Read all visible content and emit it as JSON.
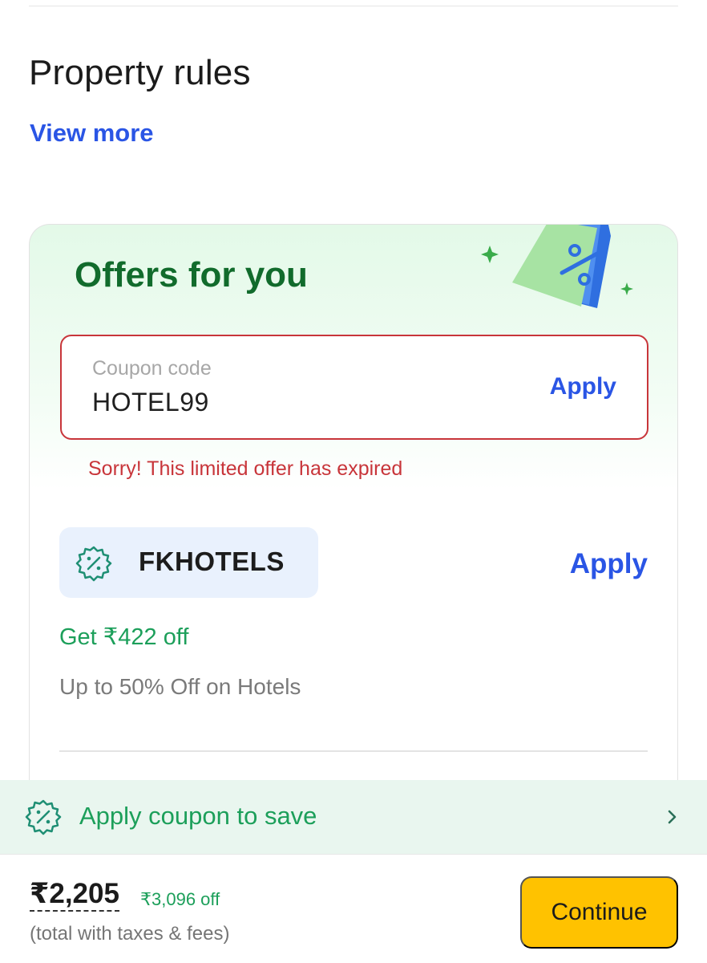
{
  "property_rules": {
    "title": "Property rules",
    "view_more": "View more"
  },
  "offers": {
    "title": "Offers for you",
    "coupon_input": {
      "label": "Coupon code",
      "value": "HOTEL99",
      "apply_label": "Apply",
      "error": "Sorry! This limited offer has expired"
    },
    "items": [
      {
        "code": "FKHOTELS",
        "apply_label": "Apply",
        "savings": "Get ₹422 off",
        "description": "Up to 50% Off on Hotels"
      }
    ]
  },
  "apply_strip": {
    "label": "Apply coupon to save"
  },
  "footer": {
    "price": "₹2,205",
    "discount": "₹3,096 off",
    "tax_note": "(total with taxes & fees)",
    "continue_label": "Continue"
  },
  "icons": {
    "coupon": "discount-badge-icon",
    "chevron": "chevron-right-icon",
    "tag": "percent-tag-illustration",
    "sparkle": "sparkle-icon"
  },
  "colors": {
    "link_blue": "#2a55e5",
    "offer_green": "#116b2c",
    "save_green": "#1c9f5a",
    "error_red": "#c8353a",
    "continue_yellow": "#ffc200"
  }
}
